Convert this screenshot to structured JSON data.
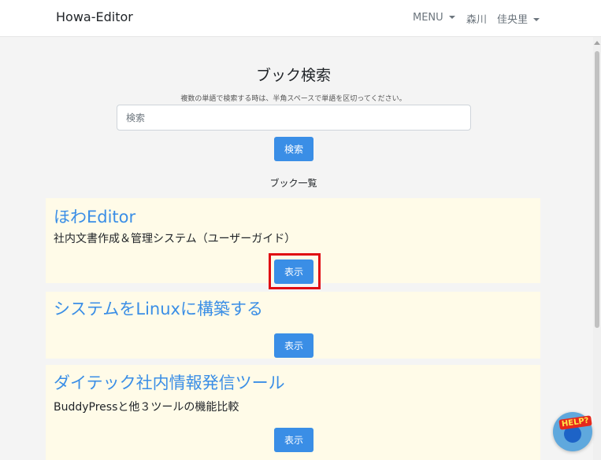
{
  "navbar": {
    "brand": "Howa-Editor",
    "menu_label": "MENU",
    "user_name": "森川　佳央里"
  },
  "search": {
    "title": "ブック検索",
    "hint": "複数の単語で検索する時は、半角スペースで単語を区切ってください。",
    "placeholder": "検索",
    "value": "",
    "button_label": "検索"
  },
  "book_list": {
    "heading": "ブック一覧",
    "books": [
      {
        "title": "ほわEditor",
        "subtitle": "社内文書作成＆管理システム（ユーザーガイド）",
        "button_label": "表示"
      },
      {
        "title": "システムをLinuxに構築する",
        "subtitle": "",
        "button_label": "表示"
      },
      {
        "title": "ダイテック社内情報発信ツール",
        "subtitle": "BuddyPressと他３ツールの機能比較",
        "button_label": "表示"
      }
    ]
  },
  "help": {
    "label": "HELP?"
  },
  "colors": {
    "accent": "#3a8ee6",
    "card_background": "#fffbe8",
    "highlight": "#e00b12"
  }
}
